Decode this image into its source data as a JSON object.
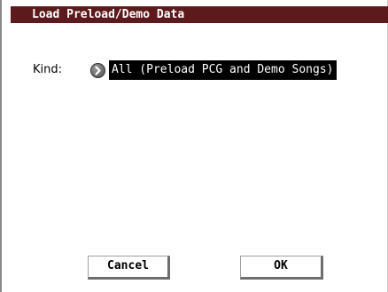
{
  "dialog": {
    "title": "Load Preload/Demo Data"
  },
  "kind": {
    "label": "Kind:",
    "popup_icon": "chevron-right-circle-icon",
    "value": "All (Preload PCG and Demo Songs)"
  },
  "buttons": {
    "cancel_label": "Cancel",
    "ok_label": "OK"
  },
  "colors": {
    "title_bar": "#5c1a1c",
    "selected_value_bg": "#000000",
    "selected_value_text": "#ffffff"
  }
}
